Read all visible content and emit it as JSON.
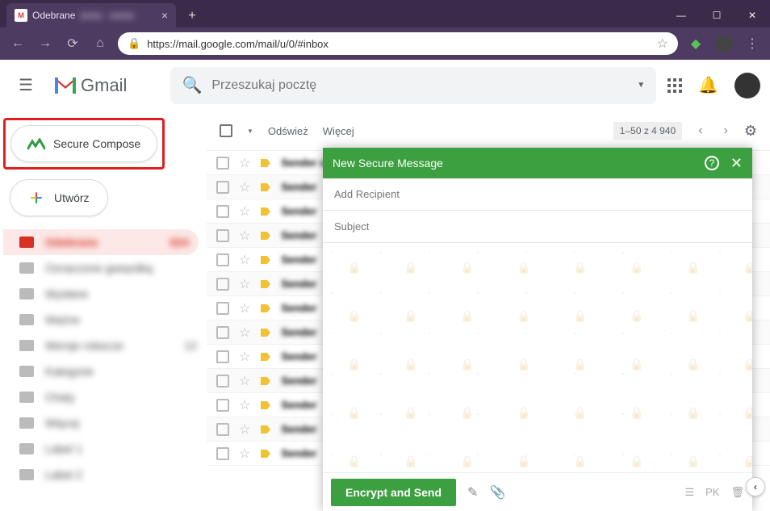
{
  "browser": {
    "tab_title": "Odebrane",
    "url": "https://mail.google.com/mail/u/0/#inbox"
  },
  "header": {
    "brand": "Gmail",
    "search_placeholder": "Przeszukaj pocztę"
  },
  "sidebar": {
    "secure_compose": "Secure Compose",
    "compose": "Utwórz"
  },
  "toolbar": {
    "refresh": "Odśwież",
    "more": "Więcej",
    "page_info": "1–50 z 4 940"
  },
  "compose": {
    "title": "New Secure Message",
    "recipient_placeholder": "Add Recipient",
    "subject_placeholder": "Subject",
    "send": "Encrypt and Send",
    "pk": "PK"
  }
}
